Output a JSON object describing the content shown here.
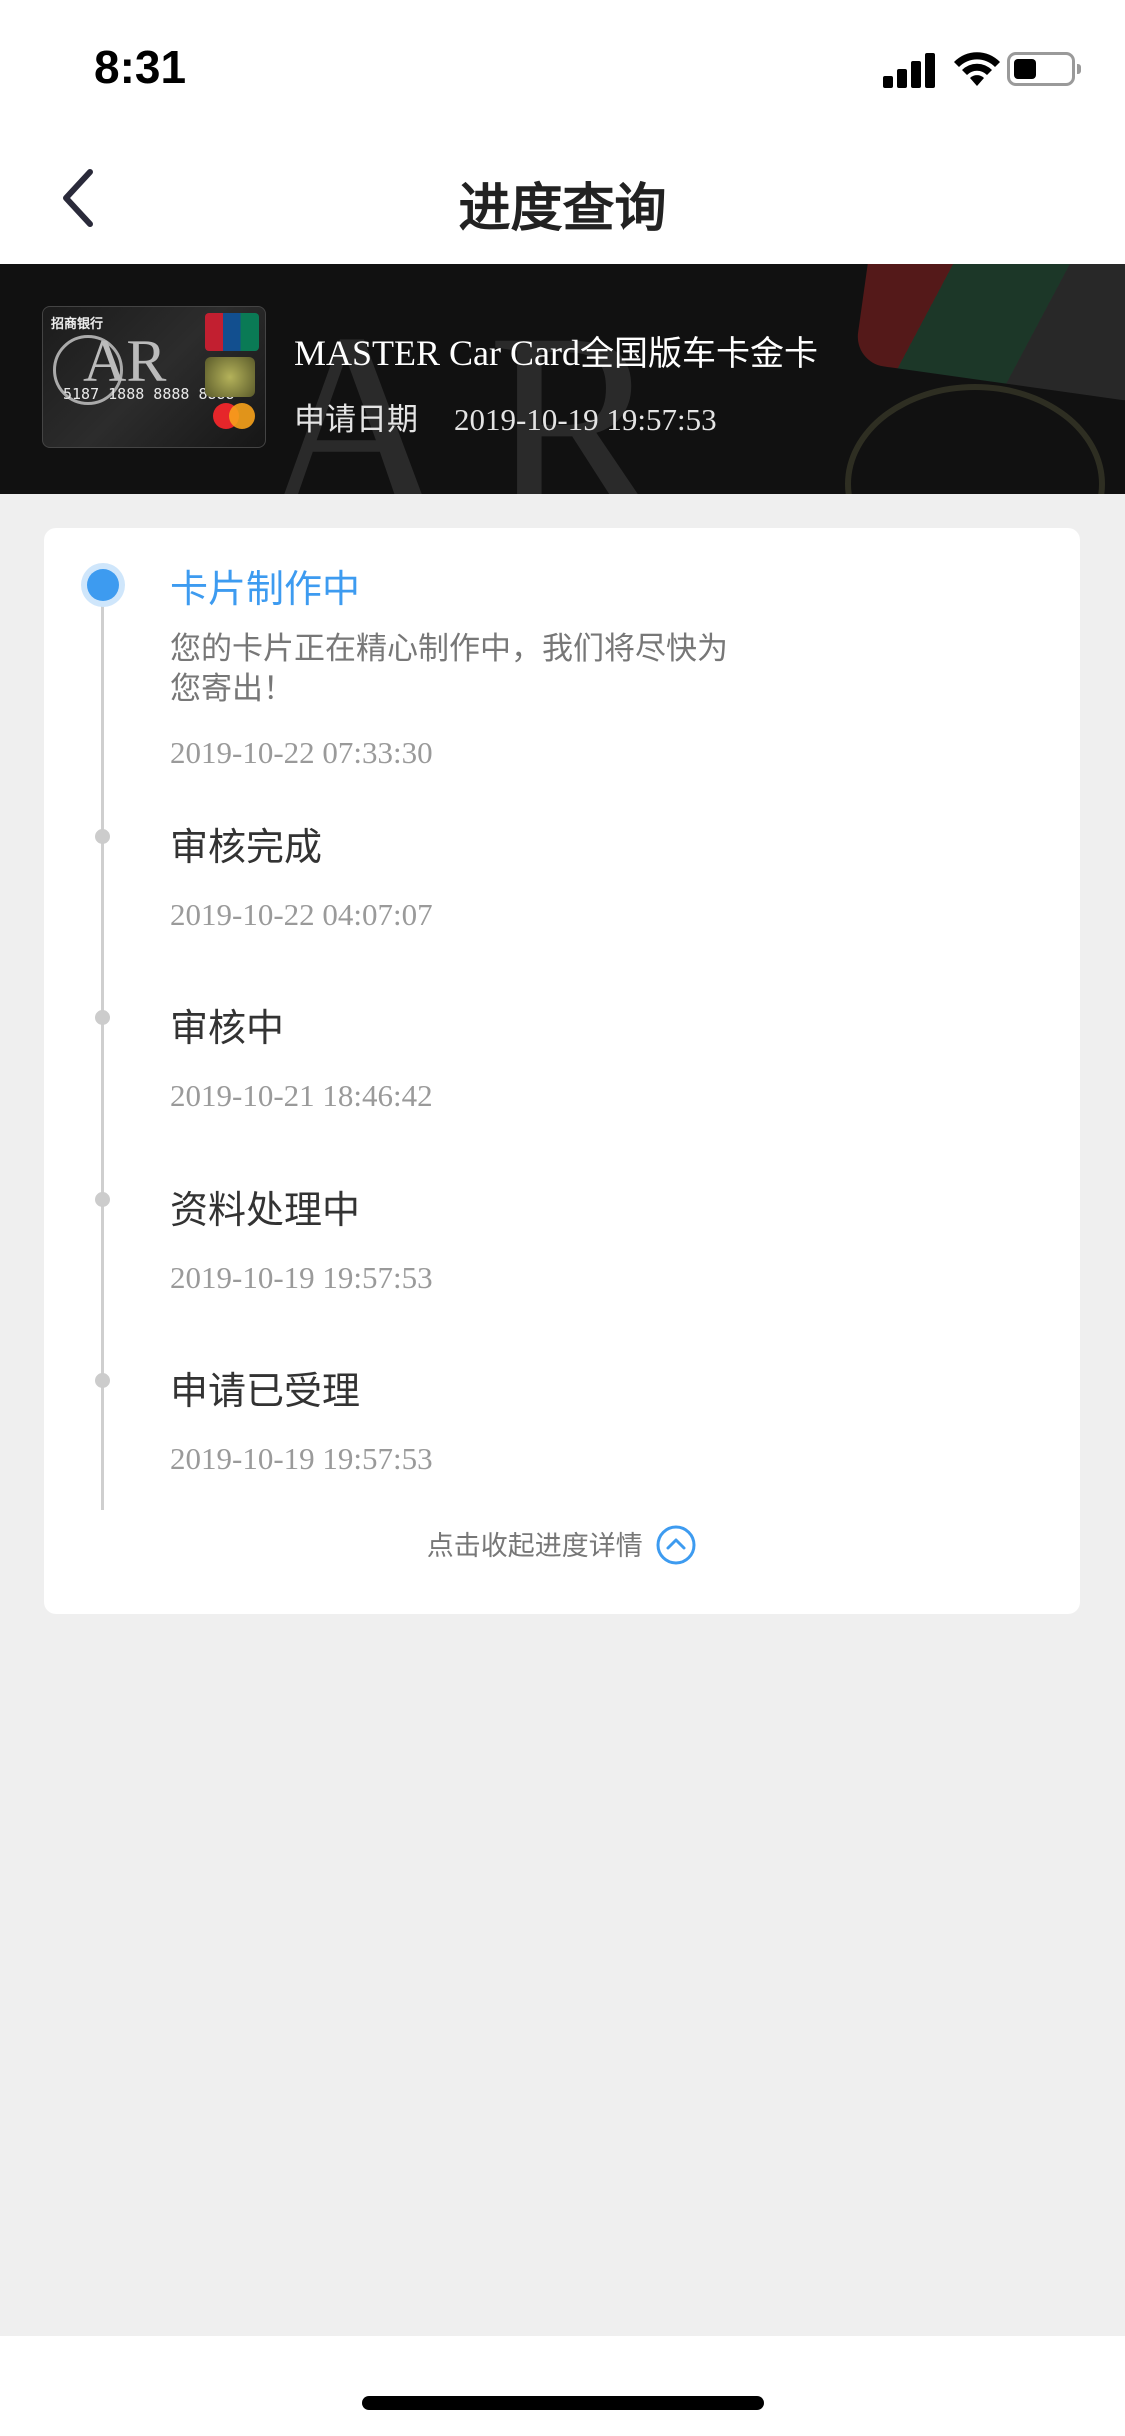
{
  "status_bar": {
    "time": "8:31"
  },
  "nav": {
    "title": "进度查询"
  },
  "card": {
    "name_latin": "MASTER Car Card",
    "name_cn": "全国版车卡金卡",
    "apply_label": "申请日期",
    "apply_date": "2019-10-19 19:57:53",
    "thumb": {
      "bank": "招商银行",
      "brand": "AR",
      "number": "5187 1888 8888 8888"
    }
  },
  "progress": {
    "steps": [
      {
        "title": "卡片制作中",
        "desc": "您的卡片正在精心制作中，我们将尽快为您寄出！",
        "time": "2019-10-22 07:33:30",
        "active": true
      },
      {
        "title": "审核完成",
        "time": "2019-10-22 04:07:07"
      },
      {
        "title": "审核中",
        "time": "2019-10-21 18:46:42"
      },
      {
        "title": "资料处理中",
        "time": "2019-10-19 19:57:53"
      },
      {
        "title": "申请已受理",
        "time": "2019-10-19 19:57:53"
      }
    ],
    "collapse_label": "点击收起进度详情"
  },
  "colors": {
    "accent": "#3d9bf0",
    "background": "#efefef"
  },
  "icons": {
    "back": "chevron-left-icon",
    "collapse": "chevron-up-circle-icon"
  }
}
